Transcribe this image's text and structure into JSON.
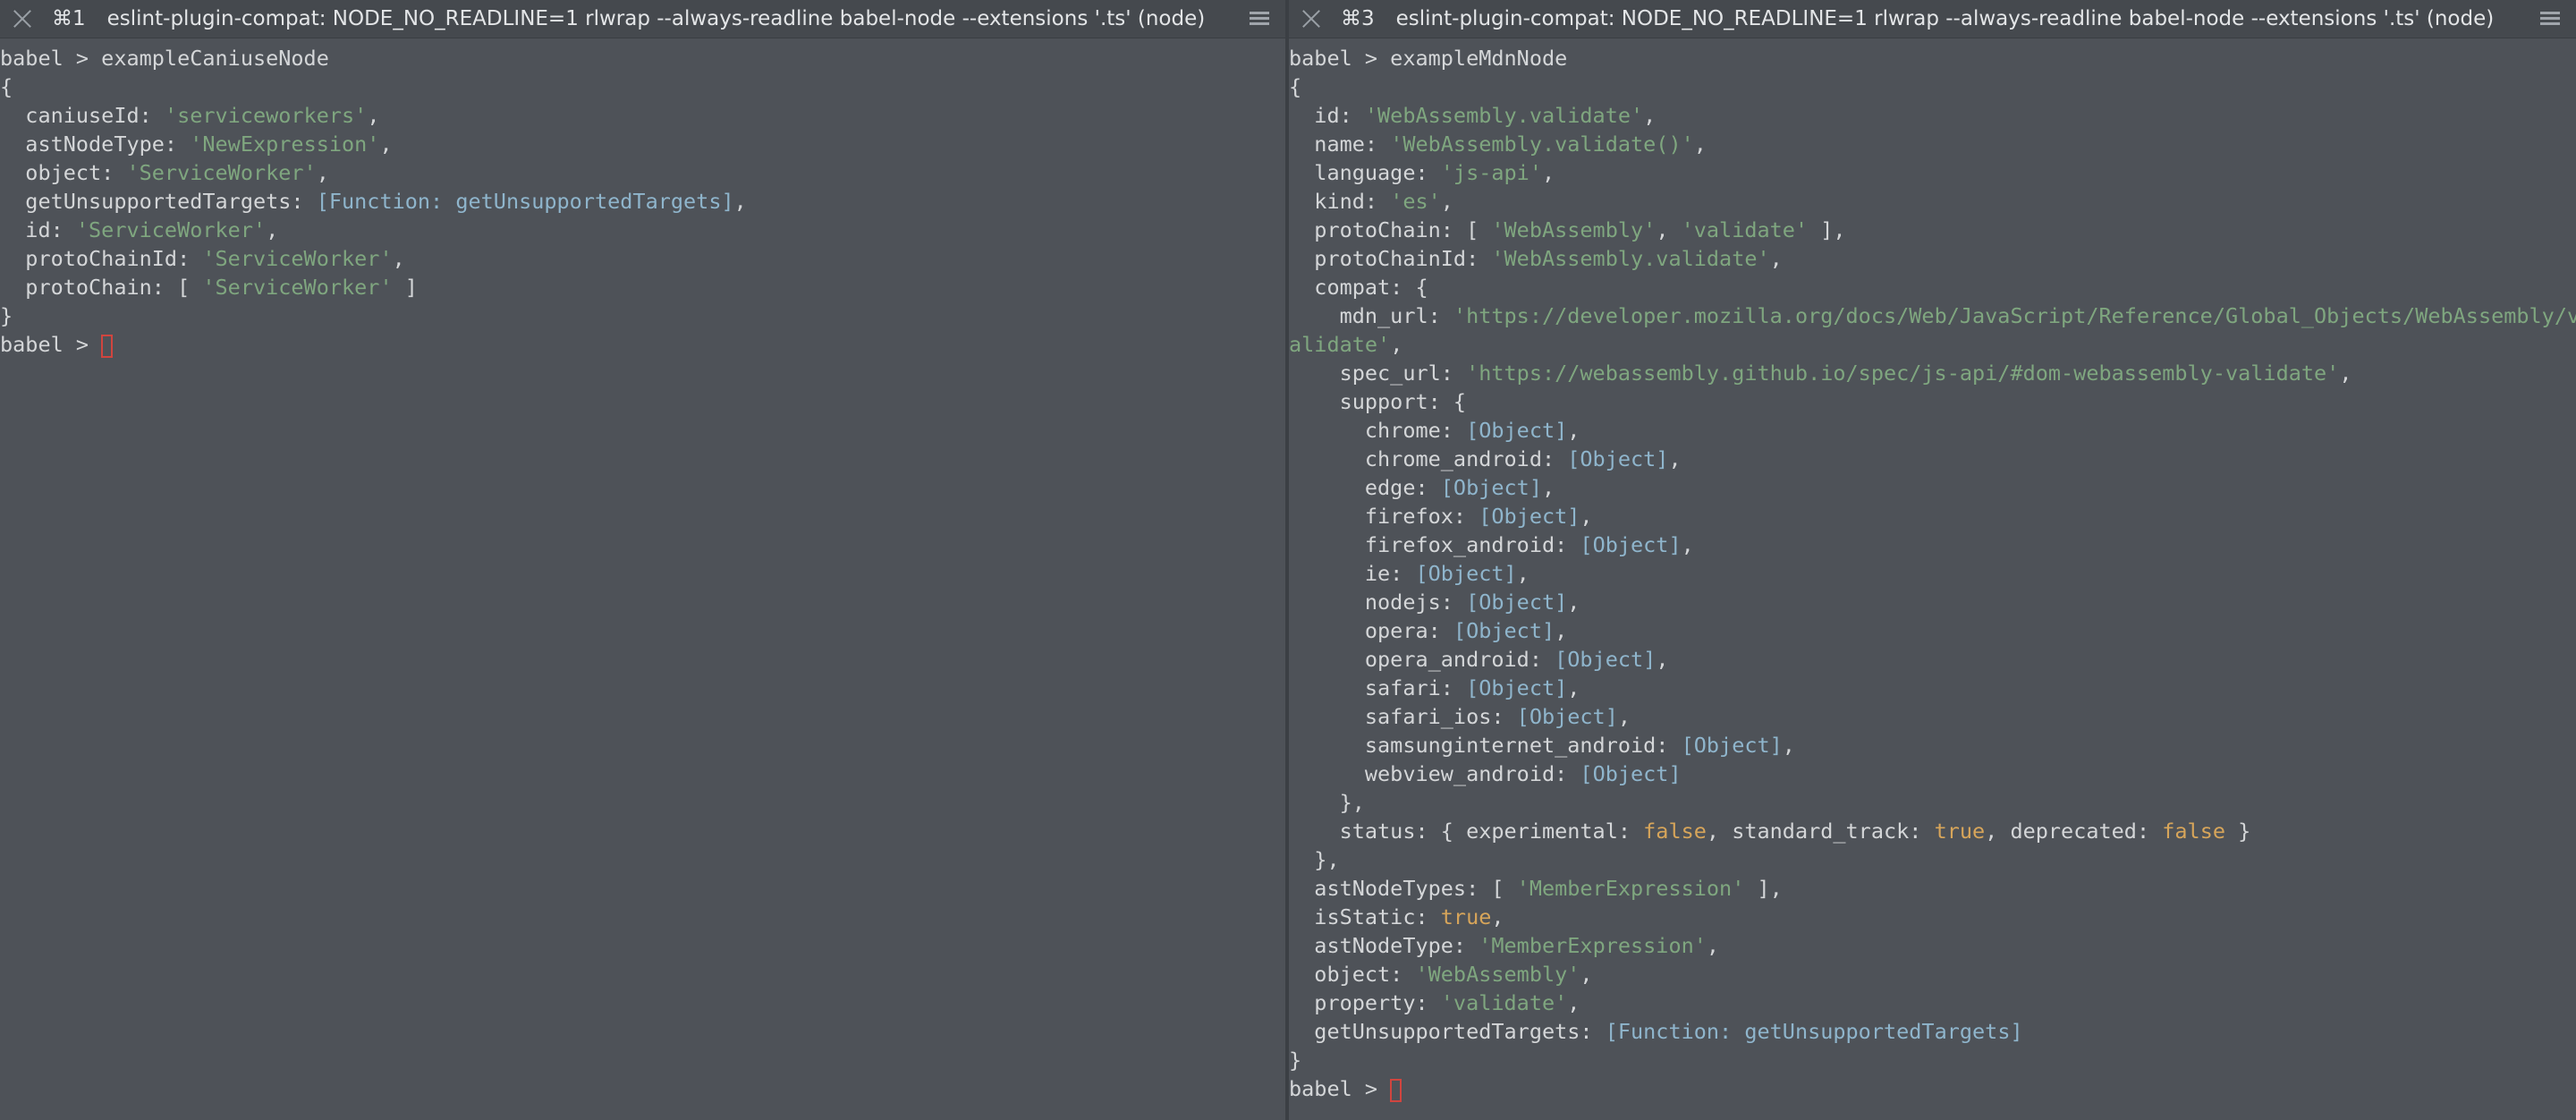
{
  "left_tab": {
    "number": "⌘1",
    "title": "eslint-plugin-compat: NODE_NO_READLINE=1 rlwrap --always-readline babel-node --extensions '.ts' (node)"
  },
  "right_tab": {
    "number": "⌘3",
    "title": "eslint-plugin-compat: NODE_NO_READLINE=1 rlwrap --always-readline babel-node --extensions '.ts' (node)"
  },
  "left_terminal": {
    "prompt": "babel > exampleCaniuseNode",
    "fields": [
      {
        "key": "caniuseId",
        "value": "'serviceworkers'",
        "kind": "str"
      },
      {
        "key": "astNodeType",
        "value": "'NewExpression'",
        "kind": "str"
      },
      {
        "key": "object",
        "value": "'ServiceWorker'",
        "kind": "str"
      },
      {
        "key": "getUnsupportedTargets",
        "value": "[Function: getUnsupportedTargets]",
        "kind": "fn"
      },
      {
        "key": "id",
        "value": "'ServiceWorker'",
        "kind": "str"
      },
      {
        "key": "protoChainId",
        "value": "'ServiceWorker'",
        "kind": "str"
      },
      {
        "key": "protoChain",
        "value": "'ServiceWorker'",
        "kind": "arr"
      }
    ],
    "prompt_end": "babel > "
  },
  "right_terminal": {
    "prompt": "babel > exampleMdnNode",
    "id": "'WebAssembly.validate'",
    "name": "'WebAssembly.validate()'",
    "language": "'js-api'",
    "kind": "'es'",
    "protoChain_a": "'WebAssembly'",
    "protoChain_b": "'validate'",
    "protoChainId": "'WebAssembly.validate'",
    "mdn_url_line1": "'https://developer.mozilla.org/docs/Web/JavaScript/Reference/Global_Objects/WebAssembly/v",
    "mdn_url_line2": "alidate'",
    "spec_url": "'https://webassembly.github.io/spec/js-api/#dom-webassembly-validate'",
    "support": [
      "chrome",
      "chrome_android",
      "edge",
      "firefox",
      "firefox_android",
      "ie",
      "nodejs",
      "opera",
      "opera_android",
      "safari",
      "safari_ios",
      "samsunginternet_android",
      "webview_android"
    ],
    "support_value": "[Object]",
    "status_experimental": "false",
    "status_standard_track": "true",
    "status_deprecated": "false",
    "astNodeTypes": "'MemberExpression'",
    "isStatic": "true",
    "astNodeType": "'MemberExpression'",
    "object": "'WebAssembly'",
    "property": "'validate'",
    "getUnsupportedTargets": "[Function: getUnsupportedTargets]",
    "prompt_end": "babel > "
  },
  "colors": {
    "background": "#4e5258",
    "string": "#7fa67f",
    "function": "#8fb5cc",
    "boolean": "#d7a55a",
    "cursor": "#d0453f"
  }
}
